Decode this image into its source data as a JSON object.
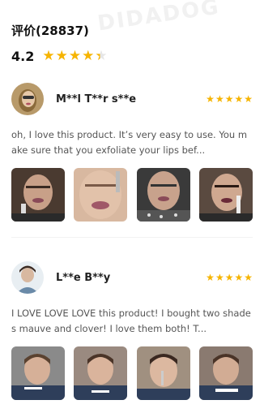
{
  "brand_watermark": "DIDADOG",
  "reviews_header": {
    "title": "评价(28837)",
    "rating": "4.2",
    "star_count": 5,
    "rating_fraction": 0.84
  },
  "reviews": [
    {
      "reviewer": "M**l T**r s**e",
      "stars": 5,
      "text": "oh, I love this product. It’s very easy to use. You make sure that you exfoliate your lips bef...",
      "photo_count": 4
    },
    {
      "reviewer": "L**e B**y",
      "stars": 5,
      "text": "I LOVE LOVE LOVE this product! I bought two shades mauve and clover! I love them both! T...",
      "photo_count": 4
    }
  ],
  "icons": {
    "star": "star-icon"
  },
  "colors": {
    "star": "#f6b400",
    "text": "#555555",
    "title": "#111111"
  }
}
